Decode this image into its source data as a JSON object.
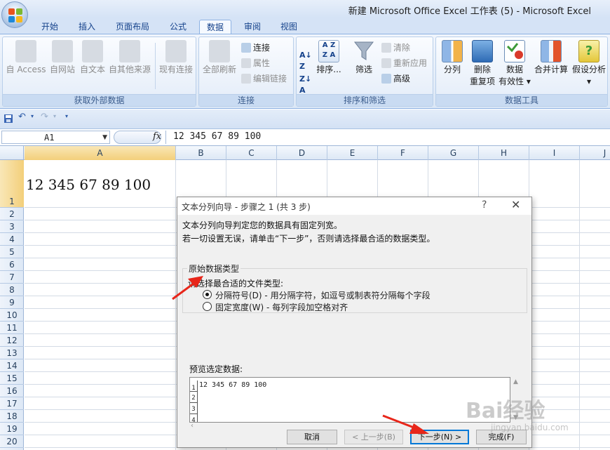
{
  "window": {
    "title": "新建 Microsoft Office Excel 工作表 (5) - Microsoft Excel"
  },
  "tabs": [
    "开始",
    "插入",
    "页面布局",
    "公式",
    "数据",
    "审阅",
    "视图"
  ],
  "active_tab": "数据",
  "ribbon": {
    "external": {
      "label": "获取外部数据",
      "access": "自 Access",
      "web": "自网站",
      "text": "自文本",
      "other": "自其他来源",
      "existing": "现有连接"
    },
    "connections": {
      "label": "连接",
      "refresh_all": "全部刷新",
      "connections": "连接",
      "properties": "属性",
      "edit_links": "编辑链接"
    },
    "sort_filter": {
      "label": "排序和筛选",
      "sort": "排序...",
      "filter": "筛选",
      "clear": "清除",
      "reapply": "重新应用",
      "advanced": "高级"
    },
    "data_tools": {
      "label": "数据工具",
      "text_to_columns": "分列",
      "remove_dup_1": "删除",
      "remove_dup_2": "重复项",
      "validation_1": "数据",
      "validation_2": "有效性 ▾",
      "consolidate": "合并计算",
      "what_if": "假设分析",
      "what_if_arrow": "▾"
    }
  },
  "formula_bar": {
    "name_box": "A1",
    "fx": "fx",
    "formula": "12 345 67 89 100"
  },
  "columns": [
    "A",
    "B",
    "C",
    "D",
    "E",
    "F",
    "G",
    "H",
    "I",
    "J"
  ],
  "rows": [
    "1",
    "2",
    "3",
    "4",
    "5",
    "6",
    "7",
    "8",
    "9",
    "10",
    "11",
    "12",
    "13",
    "14",
    "15",
    "16",
    "17",
    "18",
    "19",
    "20",
    "21"
  ],
  "cell_a1": "12 345 67 89 100",
  "dialog": {
    "title": "文本分列向导 - 步骤之 1 (共 3 步)",
    "help": "?",
    "close": "✕",
    "line1": "文本分列向导判定您的数据具有固定列宽。",
    "line2": "若一切设置无误，请单击“下一步”，否则请选择最合适的数据类型。",
    "group_title": "原始数据类型",
    "prompt": "请选择最合适的文件类型:",
    "option1": "分隔符号(D)  - 用分隔字符，如逗号或制表符分隔每个字段",
    "option2": "固定宽度(W)  - 每列字段加空格对齐",
    "preview_label": "预览选定数据:",
    "preview_rows": [
      "1",
      "2",
      "3",
      "4"
    ],
    "preview_line1": "12 345 67 89 100",
    "buttons": {
      "cancel": "取消",
      "back": "< 上一步(B)",
      "next": "下一步(N) >",
      "finish": "完成(F)"
    }
  },
  "watermark": {
    "main": "Bai经验",
    "sub": "jingyan.baidu.com"
  },
  "colors": {
    "accent": "#e8261a",
    "ribbon": "#dbe7f6",
    "selection": "#f3cf7a"
  }
}
